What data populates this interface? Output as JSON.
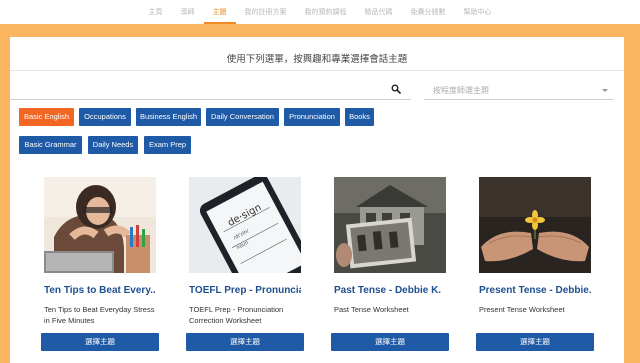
{
  "nav": {
    "items": [
      {
        "label": "主頁",
        "active": false
      },
      {
        "label": "導師",
        "active": false
      },
      {
        "label": "主題",
        "active": true
      },
      {
        "label": "我的註冊方案",
        "active": false
      },
      {
        "label": "我的預約課程",
        "active": false
      },
      {
        "label": "贈品代碼",
        "active": false
      },
      {
        "label": "免費分錢數",
        "active": false
      },
      {
        "label": "幫助中心",
        "active": false
      }
    ]
  },
  "header": {
    "heading": "使用下列選單，按興趣和專業選擇會話主題"
  },
  "filters": {
    "teacher_placeholder": "按程度師選主題",
    "tags": [
      {
        "label": "Basic English",
        "active": true
      },
      {
        "label": "Occupations",
        "active": false
      },
      {
        "label": "Business English",
        "active": false
      },
      {
        "label": "Daily Conversation",
        "active": false
      },
      {
        "label": "Pronunciation",
        "active": false
      },
      {
        "label": "Books",
        "active": false
      },
      {
        "label": "Basic Grammar",
        "active": false
      },
      {
        "label": "Daily Needs",
        "active": false
      },
      {
        "label": "Exam Prep",
        "active": false
      }
    ]
  },
  "topics": [
    {
      "title": "Ten Tips to Beat Every...",
      "desc": "Ten Tips to Beat Everyday Stress in Five Minutes",
      "button": "選擇主題",
      "image": "stressed-woman-photo"
    },
    {
      "title": "TOEFL Prep - Pronuncia...",
      "desc": "TOEFL Prep - Pronunciation Correction Worksheet",
      "button": "選擇主題",
      "image": "phone-design-photo"
    },
    {
      "title": "Past Tense - Debbie K.",
      "desc": "Past Tense Worksheet",
      "button": "選擇主題",
      "image": "old-photo-house"
    },
    {
      "title": "Present Tense - Debbie...",
      "desc": "Present Tense Worksheet",
      "button": "選擇主題",
      "image": "hands-flower-photo"
    }
  ],
  "colors": {
    "accent": "#f08a24",
    "frame": "#fbb55e",
    "tag_blue": "#1f5aa6",
    "tag_active": "#f26522",
    "title_blue": "#1f4f8f"
  }
}
